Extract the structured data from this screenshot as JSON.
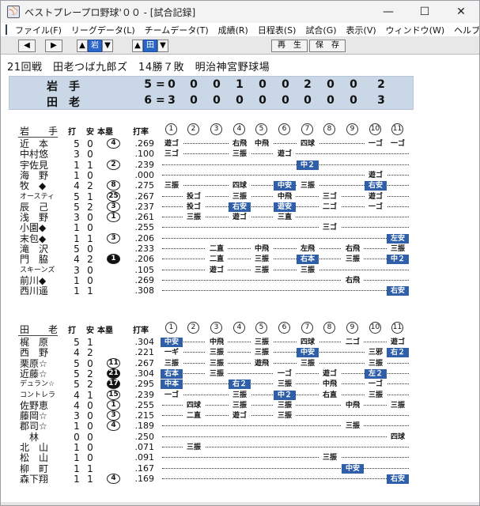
{
  "window": {
    "title": "ベストプレープロ野球'００ - [試合記録]",
    "minimize": "—",
    "maximize": "☐",
    "close": "✕"
  },
  "menu": [
    "ファイル(F)",
    "リーグデータ(L)",
    "チームデータ(T)",
    "成績(R)",
    "日程表(S)",
    "試合(G)",
    "表示(V)",
    "ウィンドウ(W)",
    "ヘルプ(H)"
  ],
  "mdi_controls": [
    "—",
    "▫",
    "✕"
  ],
  "toolbar": {
    "left": "◀",
    "right": "▶",
    "up1": "▲",
    "team1": "岩",
    "down1": "▼",
    "up2": "▲",
    "team2": "田",
    "down2": "▼",
    "replay": "再　生",
    "save": "保　存"
  },
  "game_info": "21回戦　田老つば九郎ズ　14勝７敗　明治神宮野球場",
  "score": {
    "top": {
      "name": "岩手",
      "total": "5",
      "eq": "=",
      "innings": [
        "0",
        "0",
        "0",
        "1",
        "0",
        "0",
        "2",
        "0",
        "0",
        "2"
      ]
    },
    "bottom": {
      "name": "田老",
      "total": "6",
      "eq": "=",
      "innings": [
        "3",
        "0",
        "0",
        "0",
        "0",
        "0",
        "0",
        "0",
        "0",
        "3"
      ]
    }
  },
  "headers": {
    "ab": "打",
    "h": "安",
    "hr": "本塁",
    "avg": "打率",
    "innings": [
      "1",
      "2",
      "3",
      "4",
      "5",
      "6",
      "7",
      "8",
      "9",
      "10",
      "11"
    ]
  },
  "team1": {
    "name": "岩　手",
    "players": [
      {
        "name": "近　本",
        "ab": "5",
        "h": "0",
        "hr": "4",
        "hrf": false,
        "avg": ".269",
        "r": [
          [
            1,
            "遊ゴ",
            0
          ],
          [
            4,
            "右飛",
            0
          ],
          [
            5,
            "中飛",
            0
          ],
          [
            7,
            "四球",
            0
          ],
          [
            10,
            "一ゴ",
            0
          ],
          [
            11,
            "一ゴ",
            0
          ]
        ]
      },
      {
        "name": "中村悠",
        "ab": "3",
        "h": "0",
        "hr": "",
        "hrf": false,
        "avg": ".100",
        "r": [
          [
            1,
            "三ゴ",
            0
          ],
          [
            4,
            "三振",
            0
          ],
          [
            6,
            "遊ゴ",
            0
          ]
        ]
      },
      {
        "name": "宇佐見",
        "ab": "1",
        "h": "1",
        "hr": "2",
        "hrf": false,
        "avg": ".239",
        "r": [
          [
            7,
            "中２",
            1
          ]
        ]
      },
      {
        "name": "海　野",
        "ab": "1",
        "h": "0",
        "hr": "",
        "hrf": false,
        "avg": ".000",
        "r": [
          [
            10,
            "遊ゴ",
            0
          ]
        ]
      },
      {
        "name": "牧　◆",
        "ab": "4",
        "h": "2",
        "hr": "8",
        "hrf": false,
        "avg": ".275",
        "r": [
          [
            1,
            "三振",
            0
          ],
          [
            4,
            "四球",
            0
          ],
          [
            6,
            "中安",
            1
          ],
          [
            7,
            "三振",
            0
          ],
          [
            10,
            "右安",
            1
          ]
        ]
      },
      {
        "name": "オースティン",
        "sq": true,
        "ab": "5",
        "h": "1",
        "hr": "25",
        "hrf": false,
        "avg": ".267",
        "r": [
          [
            2,
            "投ゴ",
            0
          ],
          [
            4,
            "三振",
            0
          ],
          [
            6,
            "中飛",
            0
          ],
          [
            8,
            "三ゴ",
            0
          ],
          [
            10,
            "遊ゴ",
            0
          ]
        ]
      },
      {
        "name": "辰　己",
        "ab": "5",
        "h": "2",
        "hr": "3",
        "hrf": false,
        "avg": ".237",
        "r": [
          [
            2,
            "投ゴ",
            0
          ],
          [
            4,
            "右安",
            1
          ],
          [
            6,
            "遊安",
            1
          ],
          [
            8,
            "二ゴ",
            0
          ],
          [
            10,
            "一ゴ",
            0
          ]
        ]
      },
      {
        "name": "浅　野",
        "ab": "3",
        "h": "0",
        "hr": "1",
        "hrf": false,
        "avg": ".261",
        "r": [
          [
            2,
            "三振",
            0
          ],
          [
            4,
            "遊ゴ",
            0
          ],
          [
            6,
            "三直",
            0
          ]
        ]
      },
      {
        "name": "小園◆",
        "ab": "1",
        "h": "0",
        "hr": "",
        "hrf": false,
        "avg": ".255",
        "r": [
          [
            8,
            "三ゴ",
            0
          ]
        ]
      },
      {
        "name": "末包◆",
        "ab": "1",
        "h": "1",
        "hr": "3",
        "hrf": false,
        "avg": ".206",
        "r": [
          [
            11,
            "左安",
            1
          ]
        ]
      },
      {
        "name": "滝　沢",
        "ab": "5",
        "h": "0",
        "hr": "",
        "hrf": false,
        "avg": ".233",
        "r": [
          [
            3,
            "二直",
            0
          ],
          [
            5,
            "中飛",
            0
          ],
          [
            7,
            "左飛",
            0
          ],
          [
            9,
            "右飛",
            0
          ],
          [
            11,
            "三振",
            0
          ]
        ]
      },
      {
        "name": "門　脇",
        "ab": "4",
        "h": "2",
        "hr": "1",
        "hrf": true,
        "avg": ".206",
        "r": [
          [
            3,
            "二直",
            0
          ],
          [
            5,
            "三振",
            0
          ],
          [
            7,
            "右本",
            1
          ],
          [
            9,
            "三振",
            0
          ],
          [
            11,
            "中２",
            1
          ]
        ]
      },
      {
        "name": "スキーンズ☆",
        "sq": true,
        "ab": "3",
        "h": "0",
        "hr": "",
        "hrf": false,
        "avg": ".105",
        "r": [
          [
            3,
            "遊ゴ",
            0
          ],
          [
            5,
            "三振",
            0
          ],
          [
            7,
            "三振",
            0
          ]
        ]
      },
      {
        "name": "前川◆",
        "ab": "1",
        "h": "0",
        "hr": "",
        "hrf": false,
        "avg": ".269",
        "r": [
          [
            9,
            "右飛",
            0
          ]
        ]
      },
      {
        "name": "西川遥",
        "ab": "1",
        "h": "1",
        "hr": "",
        "hrf": false,
        "avg": ".308",
        "r": [
          [
            11,
            "右安",
            1
          ]
        ]
      }
    ]
  },
  "team2": {
    "name": "田　老",
    "players": [
      {
        "name": "梶　原",
        "ab": "5",
        "h": "1",
        "hr": "",
        "hrf": false,
        "avg": ".304",
        "r": [
          [
            1,
            "中安",
            1
          ],
          [
            3,
            "中飛",
            0
          ],
          [
            5,
            "三振",
            0
          ],
          [
            7,
            "四球",
            0
          ],
          [
            9,
            "二ゴ",
            0
          ],
          [
            11,
            "遊ゴ",
            0
          ]
        ]
      },
      {
        "name": "西　野",
        "ab": "4",
        "h": "2",
        "hr": "",
        "hrf": false,
        "avg": ".221",
        "r": [
          [
            1,
            "一ギ",
            0
          ],
          [
            3,
            "三振",
            0
          ],
          [
            5,
            "三振",
            0
          ],
          [
            7,
            "中安",
            1
          ],
          [
            10,
            "三邪",
            0
          ],
          [
            11,
            "右２",
            1
          ]
        ]
      },
      {
        "name": "栗原☆",
        "ab": "5",
        "h": "0",
        "hr": "11",
        "hrf": false,
        "avg": ".267",
        "r": [
          [
            1,
            "三振",
            0
          ],
          [
            3,
            "三振",
            0
          ],
          [
            5,
            "遊飛",
            0
          ],
          [
            7,
            "三振",
            0
          ],
          [
            10,
            "三振",
            0
          ]
        ]
      },
      {
        "name": "近藤☆",
        "ab": "5",
        "h": "2",
        "hr": "21",
        "hrf": true,
        "avg": ".304",
        "r": [
          [
            1,
            "右本",
            1
          ],
          [
            3,
            "三振",
            0
          ],
          [
            6,
            "一ゴ",
            0
          ],
          [
            8,
            "遊ゴ",
            0
          ],
          [
            10,
            "左２",
            1
          ]
        ]
      },
      {
        "name": "デュラン☆",
        "sq": true,
        "ab": "5",
        "h": "2",
        "hr": "17",
        "hrf": true,
        "avg": ".295",
        "r": [
          [
            1,
            "中本",
            1
          ],
          [
            4,
            "右２",
            1
          ],
          [
            6,
            "三振",
            0
          ],
          [
            8,
            "中飛",
            0
          ],
          [
            10,
            "一ゴ",
            0
          ]
        ]
      },
      {
        "name": "コントレラス",
        "sq": true,
        "ab": "4",
        "h": "1",
        "hr": "15",
        "hrf": false,
        "avg": ".239",
        "r": [
          [
            1,
            "一ゴ",
            0
          ],
          [
            4,
            "三振",
            0
          ],
          [
            6,
            "中２",
            1
          ],
          [
            8,
            "右直",
            0
          ],
          [
            10,
            "三振",
            0
          ]
        ]
      },
      {
        "name": "佐野恵",
        "ab": "4",
        "h": "0",
        "hr": "1",
        "hrf": false,
        "avg": ".255",
        "r": [
          [
            2,
            "四球",
            0
          ],
          [
            4,
            "三振",
            0
          ],
          [
            6,
            "三振",
            0
          ],
          [
            9,
            "中飛",
            0
          ],
          [
            11,
            "三振",
            0
          ]
        ]
      },
      {
        "name": "藤岡☆",
        "ab": "3",
        "h": "0",
        "hr": "3",
        "hrf": false,
        "avg": ".215",
        "r": [
          [
            2,
            "二直",
            0
          ],
          [
            4,
            "遊ゴ",
            0
          ],
          [
            6,
            "三振",
            0
          ]
        ]
      },
      {
        "name": "郡司☆",
        "ab": "1",
        "h": "0",
        "hr": "4",
        "hrf": false,
        "avg": ".189",
        "r": [
          [
            9,
            "三振",
            0
          ]
        ]
      },
      {
        "name": "　林",
        "ab": "0",
        "h": "0",
        "hr": "",
        "hrf": false,
        "avg": ".250",
        "r": [
          [
            11,
            "四球",
            0
          ]
        ]
      },
      {
        "name": "北　山",
        "ab": "1",
        "h": "0",
        "hr": "",
        "hrf": false,
        "avg": ".071",
        "r": [
          [
            2,
            "三振",
            0
          ]
        ]
      },
      {
        "name": "松　山",
        "ab": "1",
        "h": "0",
        "hr": "",
        "hrf": false,
        "avg": ".091",
        "r": [
          [
            8,
            "三振",
            0
          ]
        ]
      },
      {
        "name": "柳　町",
        "ab": "1",
        "h": "1",
        "hr": "",
        "hrf": false,
        "avg": ".167",
        "r": [
          [
            9,
            "中安",
            1
          ]
        ]
      },
      {
        "name": "森下翔",
        "ab": "1",
        "h": "1",
        "hr": "4",
        "hrf": false,
        "avg": ".169",
        "r": [
          [
            11,
            "右安",
            1
          ]
        ]
      }
    ]
  }
}
